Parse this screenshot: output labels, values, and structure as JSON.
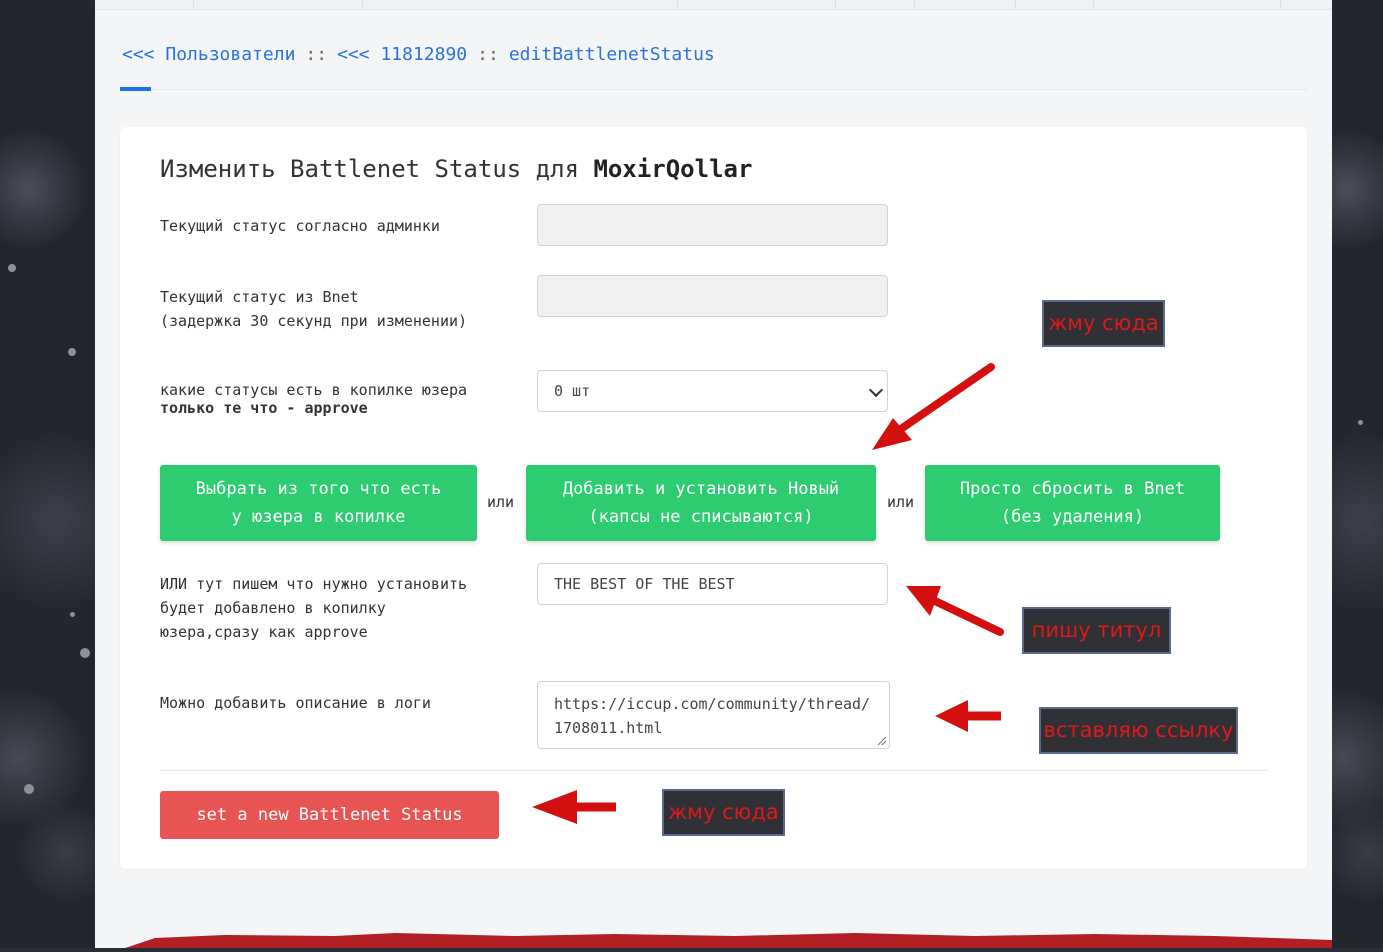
{
  "breadcrumb": {
    "back1": "<<<",
    "users": "Пользователи",
    "sep1": "::",
    "back2": "<<<",
    "user_id": "11812890",
    "sep2": "::",
    "current": "editBattlenetStatus"
  },
  "form": {
    "title_prefix": "Изменить Battlenet Status для",
    "title_user": "MoxirQollar",
    "row1_label": "Текущий статус согласно админки",
    "row1_value": "",
    "row2_label_line1": "Текущий статус из Bnet",
    "row2_label_line2": "(задержка 30 секунд при изменении)",
    "row2_value": "",
    "row3_label_line1": "какие статусы есть в копилке юзера",
    "row3_label_line2": "только те что - approve",
    "row3_select_value": "0 шт",
    "btn_choose_line1": "Выбрать из того что есть",
    "btn_choose_line2": "у юзера в копилке",
    "or1": "или",
    "btn_add_line1": "Добавить и установить Новый",
    "btn_add_line2": "(капсы не списываются)",
    "or2": "или",
    "btn_reset_line1": "Просто сбросить в Bnet",
    "btn_reset_line2": "(без удаления)",
    "row4_label_line1": "ИЛИ тут пишем что нужно установить",
    "row4_label_line2": "будет добавлено в копилку",
    "row4_label_line3": "юзера,сразу как approve",
    "row4_value": "THE BEST OF THE BEST",
    "row5_label": "Можно добавить описание в логи",
    "row5_value": "https://iccup.com/community/thread/1708011.html",
    "submit_label": "set a new Battlenet Status"
  },
  "annotations": {
    "note_top": "жму сюда",
    "note_title": "пишу титул",
    "note_link": "вставляю ссылку",
    "note_submit": "жму сюда",
    "arrow_color": "#d40f0f"
  },
  "colors": {
    "link": "#2a73d9",
    "green_button": "#2dcc71",
    "red_button": "#e85454"
  }
}
